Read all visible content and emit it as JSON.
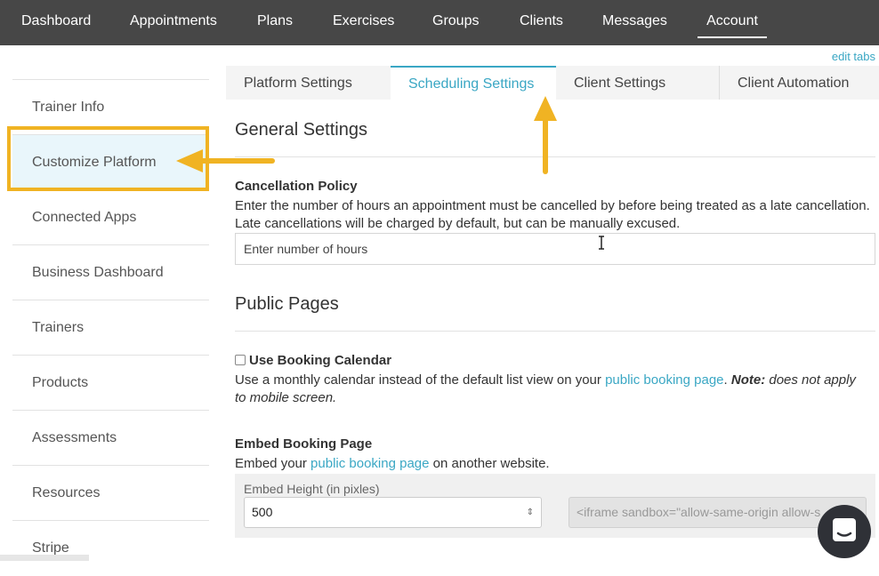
{
  "topnav": {
    "items": [
      "Dashboard",
      "Appointments",
      "Plans",
      "Exercises",
      "Groups",
      "Clients",
      "Messages",
      "Account"
    ],
    "active": "Account"
  },
  "edit_tabs": "edit tabs",
  "sidebar": {
    "items": [
      "Trainer Info",
      "Customize Platform",
      "Connected Apps",
      "Business Dashboard",
      "Trainers",
      "Products",
      "Assessments",
      "Resources",
      "Stripe"
    ]
  },
  "tabs": [
    "Platform Settings",
    "Scheduling Settings",
    "Client Settings",
    "Client Automation"
  ],
  "general": {
    "heading": "General Settings",
    "cancellation_label": "Cancellation Policy",
    "cancellation_desc": "Enter the number of hours an appointment must be cancelled by before being treated as a late cancellation. Late cancellations will be charged by default, but can be manually excused.",
    "hours_placeholder": "Enter number of hours"
  },
  "public": {
    "heading": "Public Pages",
    "booking_calendar_label": "Use Booking Calendar",
    "booking_desc_1": "Use a monthly calendar instead of the default list view on your ",
    "booking_link": "public booking page",
    "booking_desc_2": ". ",
    "note_label": "Note:",
    "note_text": " does not apply to mobile screen.",
    "embed_label": "Embed Booking Page",
    "embed_desc_1": "Embed your ",
    "embed_link": "public booking page",
    "embed_desc_2": " on another website.",
    "embed_height_label": "Embed Height (in pixles)",
    "embed_height_value": "500",
    "iframe_code": "<iframe sandbox=\"allow-same-origin allow-s"
  },
  "colors": {
    "nav_bg": "#474747",
    "accent": "#3aa7c4",
    "highlight": "#f0b323",
    "chat_bg": "#2f3137"
  }
}
